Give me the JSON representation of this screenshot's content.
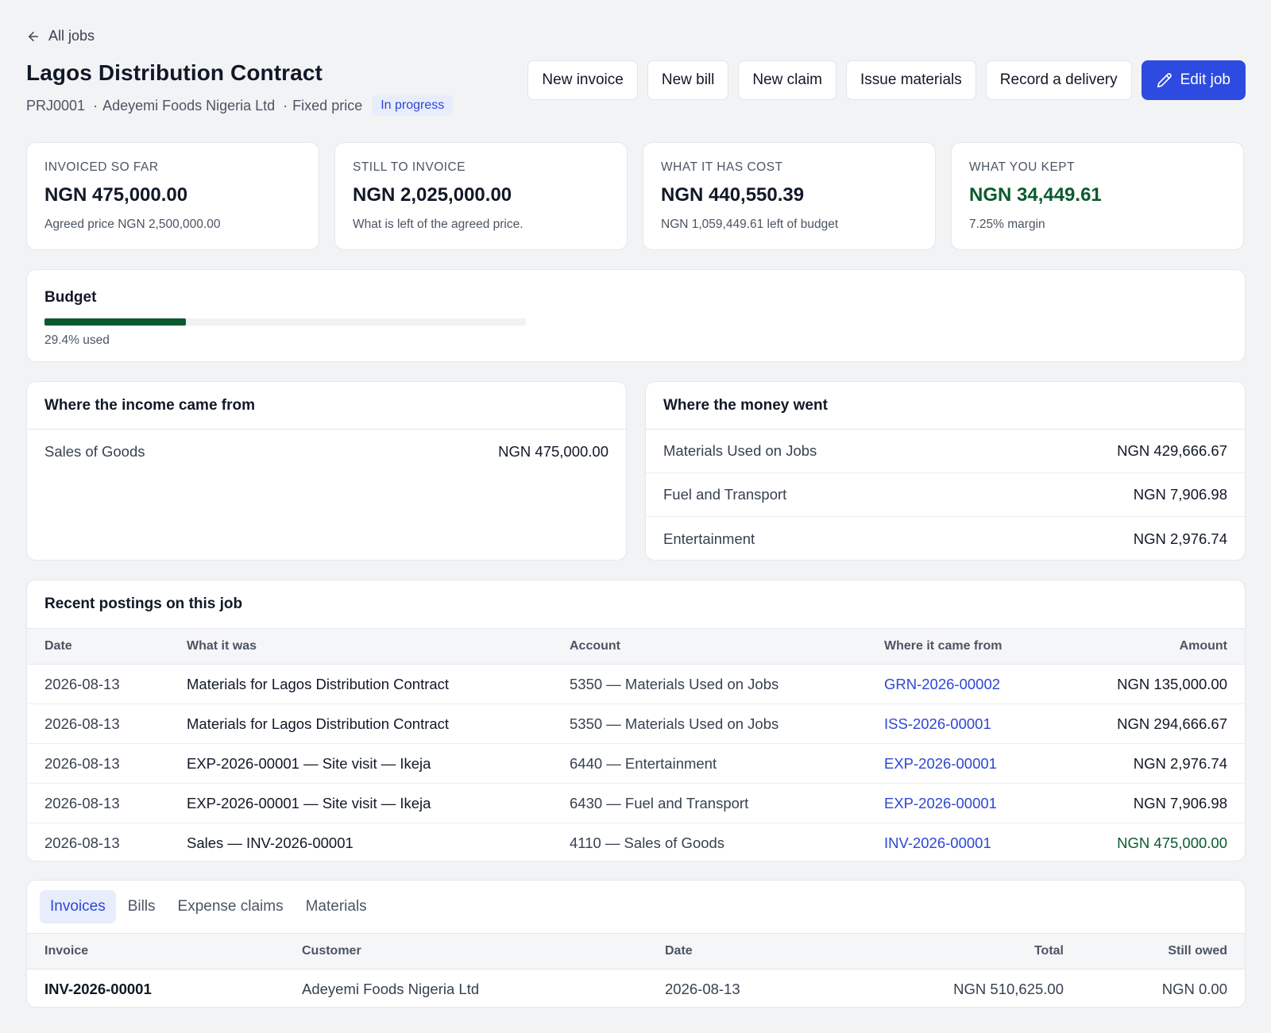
{
  "back": {
    "label": "All jobs"
  },
  "job": {
    "title": "Lagos Distribution Contract",
    "code": "PRJ0001",
    "customer": "Adeyemi Foods Nigeria Ltd",
    "pricing": "Fixed price",
    "status": "In progress",
    "separator": "·"
  },
  "actions": {
    "new_invoice": "New invoice",
    "new_bill": "New bill",
    "new_claim": "New claim",
    "issue_materials": "Issue materials",
    "record_delivery": "Record a delivery",
    "edit_job": "Edit job"
  },
  "stats": [
    {
      "label": "INVOICED SO FAR",
      "value": "NGN 475,000.00",
      "sub": "Agreed price NGN 2,500,000.00"
    },
    {
      "label": "STILL TO INVOICE",
      "value": "NGN 2,025,000.00",
      "sub": "What is left of the agreed price."
    },
    {
      "label": "WHAT IT HAS COST",
      "value": "NGN 440,550.39",
      "sub": "NGN 1,059,449.61 left of budget"
    },
    {
      "label": "WHAT YOU KEPT",
      "value": "NGN 34,449.61",
      "sub": "7.25% margin"
    }
  ],
  "budget": {
    "title": "Budget",
    "used_fraction": 0.294,
    "used_label": "29.4% used"
  },
  "income": {
    "title": "Where the income came from",
    "rows": [
      {
        "name": "Sales of Goods",
        "amount": "NGN 475,000.00"
      }
    ]
  },
  "spending": {
    "title": "Where the money went",
    "rows": [
      {
        "name": "Materials Used on Jobs",
        "amount": "NGN 429,666.67"
      },
      {
        "name": "Fuel and Transport",
        "amount": "NGN 7,906.98"
      },
      {
        "name": "Entertainment",
        "amount": "NGN 2,976.74"
      }
    ]
  },
  "postings": {
    "title": "Recent postings on this job",
    "columns": [
      "Date",
      "What it was",
      "Account",
      "Where it came from",
      "Amount"
    ],
    "rows": [
      {
        "date": "2026-08-13",
        "what": "Materials for Lagos Distribution Contract",
        "account": "5350 — Materials Used on Jobs",
        "source": "GRN-2026-00002",
        "amount": "NGN 135,000.00"
      },
      {
        "date": "2026-08-13",
        "what": "Materials for Lagos Distribution Contract",
        "account": "5350 — Materials Used on Jobs",
        "source": "ISS-2026-00001",
        "amount": "NGN 294,666.67"
      },
      {
        "date": "2026-08-13",
        "what": "EXP-2026-00001 — Site visit — Ikeja",
        "account": "6440 — Entertainment",
        "source": "EXP-2026-00001",
        "amount": "NGN 2,976.74"
      },
      {
        "date": "2026-08-13",
        "what": "EXP-2026-00001 — Site visit — Ikeja",
        "account": "6430 — Fuel and Transport",
        "source": "EXP-2026-00001",
        "amount": "NGN 7,906.98"
      },
      {
        "date": "2026-08-13",
        "what": "Sales — INV-2026-00001",
        "account": "4110 — Sales of Goods",
        "source": "INV-2026-00001",
        "amount": "NGN 475,000.00"
      }
    ]
  },
  "tabs": [
    "Invoices",
    "Bills",
    "Expense claims",
    "Materials"
  ],
  "invoices": {
    "columns": [
      "Invoice",
      "Customer",
      "Date",
      "Total",
      "Still owed"
    ],
    "rows": [
      {
        "invoice": "INV-2026-00001",
        "customer": "Adeyemi Foods Nigeria Ltd",
        "date": "2026-08-13",
        "total": "NGN 510,625.00",
        "owed": "NGN 0.00"
      }
    ]
  },
  "colors": {
    "accent": "#2d4be0",
    "positive": "#0b5a2e",
    "link": "#2d46d6"
  }
}
